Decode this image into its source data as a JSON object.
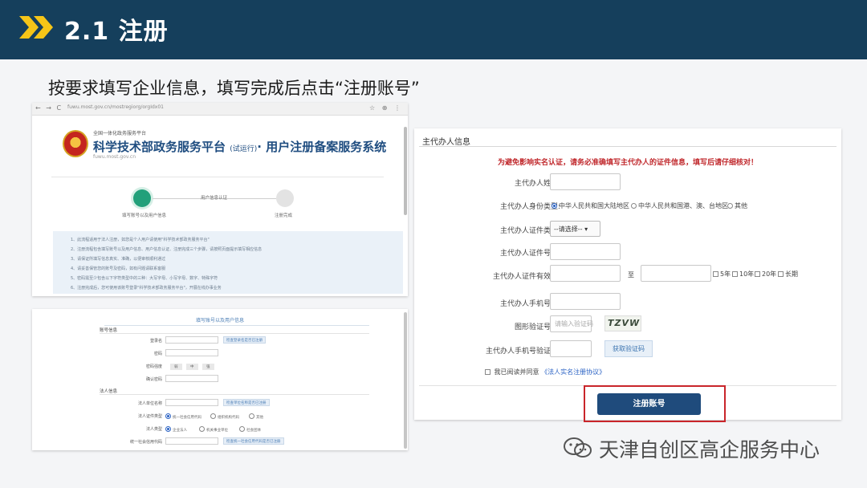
{
  "header": {
    "title": "2.1 注册"
  },
  "instruction": "按要求填写企业信息，填写完成后点击“注册账号”",
  "browser": {
    "nav_icons": "← → C",
    "url": "fuwu.most.gov.cn/mostregiorg/orgIdx01",
    "bar_icons": "☆ ⊕ ⋮",
    "portal_small": "全国一体化政务服务平台",
    "brand": "科学技术部政务服务平台",
    "brand_tag": "(试运行)",
    "brand_suffix": "· 用户注册备案服务系统",
    "site": "fuwu.most.gov.cn",
    "steps": [
      {
        "label": "填写账号以及用户信息"
      },
      {
        "label": "用户信息认证"
      },
      {
        "label": "注册完成"
      }
    ],
    "notes": [
      "1、此流程适用于法人注册，如您是个人用户请使用\"科学技术部政务服务平台\"",
      "2、注册流程包含填写账号以及用户信息、用户信息认证、注册完成三个步骤，请按照页面提示填写相应信息",
      "3、请保证所填写信息真实、准确，以便审核顺利通过",
      "4、请妥善保管您的账号及密码，如有问题请联系客服",
      "5、密码需至少包含以下字符类型中的三种：大写字母、小写字母、数字、特殊字符",
      "6、注册完成后，您可使用该账号登录\"科学技术部政务服务平台\"，开展在线办事业务"
    ]
  },
  "form_left": {
    "title": "填写账号以及用户信息",
    "section_account": "账号信息",
    "account_fields": [
      {
        "label": "登录名",
        "btn": "检查登录名是否已注册"
      },
      {
        "label": "密码"
      },
      {
        "label": "密码强度",
        "strength": [
          "弱",
          "中",
          "强"
        ]
      },
      {
        "label": "确认密码"
      }
    ],
    "section_legal": "法人信息",
    "legal_fields": [
      {
        "label": "法人单位名称",
        "btn": "检查单位名称是否已注册"
      },
      {
        "label": "法人证件类型",
        "options": [
          "统一社会信用代码",
          "组织机构代码",
          "其他"
        ]
      },
      {
        "label": "法人类型",
        "options": [
          "企业法人",
          "机关事业单位",
          "社会团体"
        ]
      },
      {
        "label": "统一社会信用代码",
        "btn": "检查统一社会信用代码是否已注册"
      }
    ]
  },
  "form_right": {
    "section_title": "主代办人信息",
    "warning": "为避免影响实名认证，请务必准确填写主代办人的证件信息，填写后请仔细核对！",
    "labels": {
      "name": "主代办人姓名:",
      "id_kind": "主代办人身份类型:",
      "cert_type": "主代办人证件类型:",
      "cert_no": "主代办人证件号码:",
      "valid": "主代办人证件有效期:",
      "phone": "主代办人手机号码:",
      "captcha": "图形验证号码:",
      "sms": "主代办人手机号验证码:"
    },
    "id_options": [
      "中华人民共和国大陆地区",
      "中华人民共和国港、澳、台地区",
      "其他"
    ],
    "cert_select": "--请选择--",
    "to": "至",
    "periods": [
      "5年",
      "10年",
      "20年",
      "长期"
    ],
    "captcha_placeholder": "请输入验证码",
    "captcha_text": "TZVW",
    "sms_button": "获取验证码",
    "agree_prefix": "我已阅读并同意",
    "agree_link": "《法人实名注册协议》",
    "register_button": "注册账号"
  },
  "watermark": "天津自创区高企服务中心",
  "colors": {
    "header_bg": "#153f5c",
    "arrow": "#f5c518",
    "register_bg": "#1f4b7c",
    "highlight": "#c9252a",
    "warning": "#c0282c"
  }
}
